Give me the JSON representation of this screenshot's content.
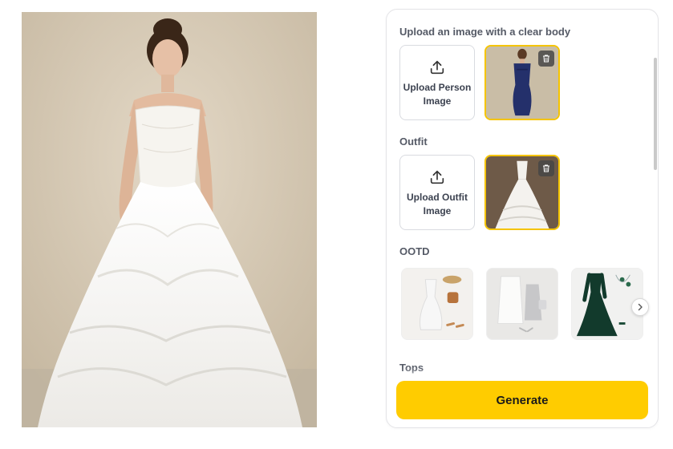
{
  "result": {
    "image_icon": "generated-bride-image"
  },
  "panel": {
    "person_section": {
      "title": "Upload an image with a clear body",
      "upload_label": "Upload Person Image"
    },
    "outfit_section": {
      "title": "Outfit",
      "upload_label": "Upload Outfit Image"
    },
    "ootd_section": {
      "title": "OOTD",
      "items": [
        "ootd-white-dress-hat",
        "ootd-white-coat-silver-dress",
        "ootd-green-velvet-gown"
      ]
    },
    "tops_section": {
      "title": "Tops"
    },
    "generate_label": "Generate",
    "colors": {
      "accent": "#ffcc00",
      "selected_border": "#f5c400"
    }
  }
}
